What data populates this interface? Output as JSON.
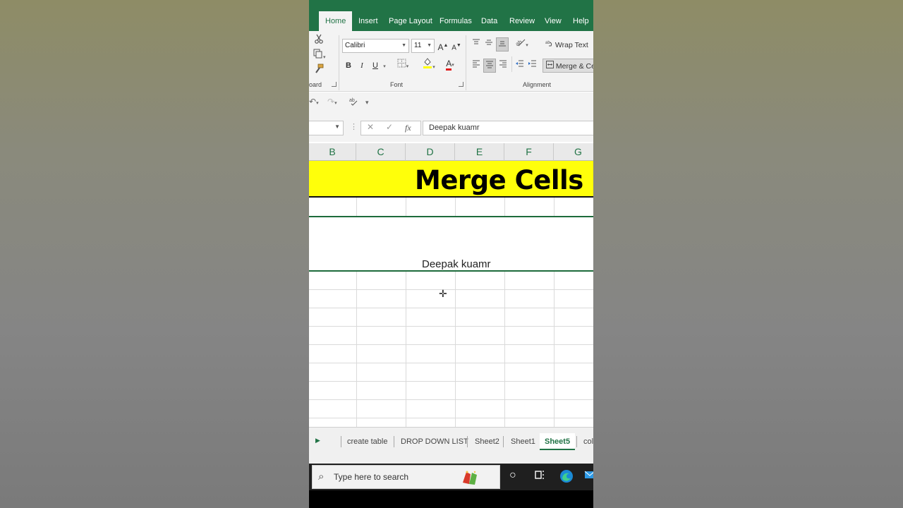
{
  "ribbon": {
    "tabs": [
      "Home",
      "Insert",
      "Page Layout",
      "Formulas",
      "Data",
      "Review",
      "View",
      "Help"
    ],
    "active_tab": "Home",
    "clipboard_label": "oard",
    "font": {
      "name": "Calibri",
      "size": "11",
      "bold": "B",
      "italic": "I",
      "underline": "U",
      "grow": "A",
      "shrink": "A",
      "font_color": "A",
      "label": "Font"
    },
    "alignment": {
      "wrap_text": "Wrap Text",
      "merge_center": "Merge & Cen",
      "label": "Alignment"
    }
  },
  "formula_bar": {
    "value": "Deepak kuamr",
    "fx": "fx"
  },
  "grid": {
    "columns": [
      "B",
      "C",
      "D",
      "E",
      "F",
      "G"
    ],
    "title": "Merge Cells",
    "merged_value": "Deepak kuamr",
    "title_fill": "#ffff0a"
  },
  "sheets": {
    "tabs": [
      "create table",
      "DROP DOWN LIST",
      "Sheet2",
      "Sheet1",
      "Sheet5",
      "col"
    ],
    "active": "Sheet5"
  },
  "taskbar": {
    "search_placeholder": "Type here to search"
  },
  "colors": {
    "excel_green": "#217346"
  }
}
